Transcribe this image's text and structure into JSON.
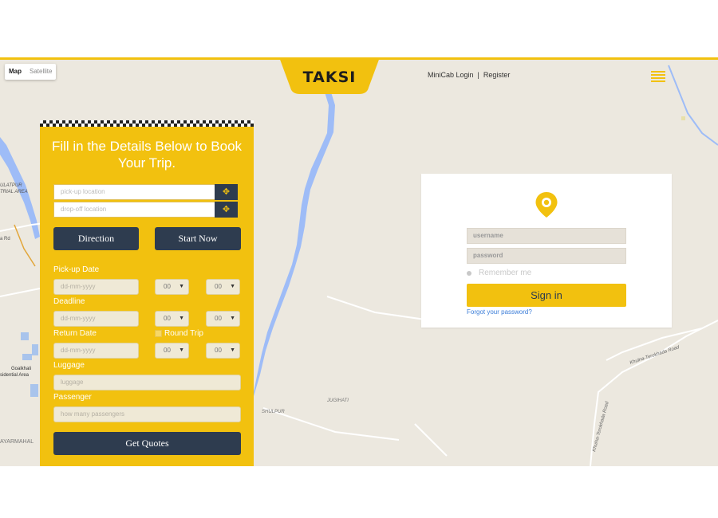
{
  "map": {
    "toggle": {
      "map": "Map",
      "satellite": "Satellite"
    },
    "labels": {
      "ulatpur": "ULATPUR",
      "industrial_area": "TRIAL AREA",
      "road_left": "a Rd",
      "goalkhali": "Goalkhali",
      "residential": "sidential Area",
      "jayarmahal": "AYARMAHAL",
      "shulpur": "SHULPUR",
      "jugihati": "JUGIHATI",
      "khulna_road_1": "Khulna-Terokhada Road",
      "khulna_road_2": "Khulna-Terokhada Road"
    }
  },
  "header": {
    "logo": "TAKSI",
    "minicab_login": "MiniCab Login",
    "separator": "|",
    "register": "Register"
  },
  "booking": {
    "title": "Fill in the Details Below to Book Your Trip.",
    "pickup_placeholder": "pick-up location",
    "dropoff_placeholder": "drop-off location",
    "direction_label": "Direction",
    "start_now_label": "Start Now",
    "pickup_date_label": "Pick-up Date",
    "deadline_label": "Deadline",
    "return_date_label": "Return Date",
    "round_trip_label": "Round Trip",
    "date_placeholder": "dd-mm-yyyy",
    "hour_value": "00",
    "minute_value": "00",
    "luggage_label": "Luggage",
    "luggage_placeholder": "luggage",
    "passenger_label": "Passenger",
    "passenger_placeholder": "how many passengers",
    "get_quotes_label": "Get Quotes"
  },
  "login": {
    "username_placeholder": "username",
    "password_placeholder": "password",
    "remember_label": "Remember me",
    "signin_label": "Sign in",
    "forgot_label": "Forgot your password?"
  },
  "colors": {
    "accent": "#f2c10f",
    "navy": "#2e3c4f",
    "map_bg": "#ece8df",
    "river": "#9ebcf7"
  }
}
